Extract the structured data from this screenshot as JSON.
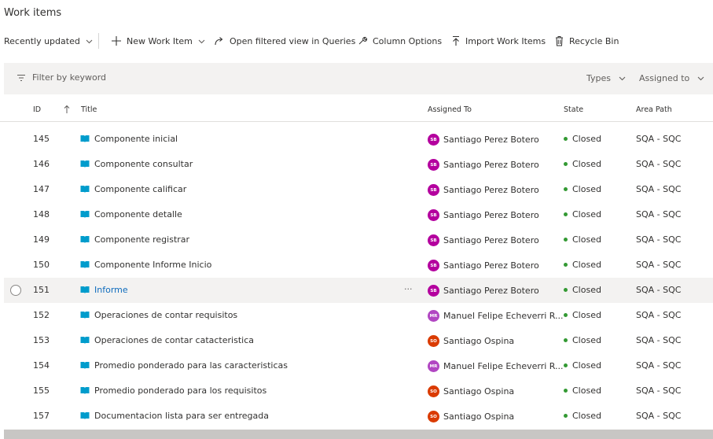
{
  "page": {
    "title": "Work items"
  },
  "toolbar": {
    "recently_updated": "Recently updated",
    "new_work_item": "New Work Item",
    "open_in_queries": "Open filtered view in Queries",
    "column_options": "Column Options",
    "import_work_items": "Import Work Items",
    "recycle_bin": "Recycle Bin"
  },
  "filter": {
    "placeholder": "Filter by keyword",
    "types": "Types",
    "assigned_to": "Assigned to"
  },
  "columns": {
    "id": "ID",
    "title": "Title",
    "assigned_to": "Assigned To",
    "state": "State",
    "area_path": "Area Path"
  },
  "colors": {
    "avatar_spb": "#b4009e",
    "avatar_mfe": "#b146c2",
    "avatar_so": "#da3b01",
    "state_closed": "#339933",
    "link": "#0f6cbd"
  },
  "rows": [
    {
      "id": "145",
      "title": "Componente inicial",
      "initials": "SB",
      "assigned": "Santiago Perez Botero",
      "state": "Closed",
      "area": "SQA - SQC"
    },
    {
      "id": "146",
      "title": "Componente consultar",
      "initials": "SB",
      "assigned": "Santiago Perez Botero",
      "state": "Closed",
      "area": "SQA - SQC"
    },
    {
      "id": "147",
      "title": "Componente calificar",
      "initials": "SB",
      "assigned": "Santiago Perez Botero",
      "state": "Closed",
      "area": "SQA - SQC"
    },
    {
      "id": "148",
      "title": "Componente detalle",
      "initials": "SB",
      "assigned": "Santiago Perez Botero",
      "state": "Closed",
      "area": "SQA - SQC"
    },
    {
      "id": "149",
      "title": "Componente registrar",
      "initials": "SB",
      "assigned": "Santiago Perez Botero",
      "state": "Closed",
      "area": "SQA - SQC"
    },
    {
      "id": "150",
      "title": "Componente Informe Inicio",
      "initials": "SB",
      "assigned": "Santiago Perez Botero",
      "state": "Closed",
      "area": "SQA - SQC"
    },
    {
      "id": "151",
      "title": "Informe",
      "initials": "SB",
      "assigned": "Santiago Perez Botero",
      "state": "Closed",
      "area": "SQA - SQC",
      "more": "···"
    },
    {
      "id": "152",
      "title": "Operaciones de contar requisitos",
      "initials": "MR",
      "assigned": "Manuel Felipe Echeverri R...",
      "state": "Closed",
      "area": "SQA - SQC"
    },
    {
      "id": "153",
      "title": "Operaciones de contar catacteristica",
      "initials": "SO",
      "assigned": "Santiago Ospina",
      "state": "Closed",
      "area": "SQA - SQC"
    },
    {
      "id": "154",
      "title": "Promedio ponderado para las caracteristicas",
      "initials": "MR",
      "assigned": "Manuel Felipe Echeverri R...",
      "state": "Closed",
      "area": "SQA - SQC"
    },
    {
      "id": "155",
      "title": "Promedio ponderado para los requisitos",
      "initials": "SO",
      "assigned": "Santiago Ospina",
      "state": "Closed",
      "area": "SQA - SQC"
    },
    {
      "id": "157",
      "title": "Documentacion lista para ser entregada",
      "initials": "SO",
      "assigned": "Santiago Ospina",
      "state": "Closed",
      "area": "SQA - SQC"
    }
  ]
}
